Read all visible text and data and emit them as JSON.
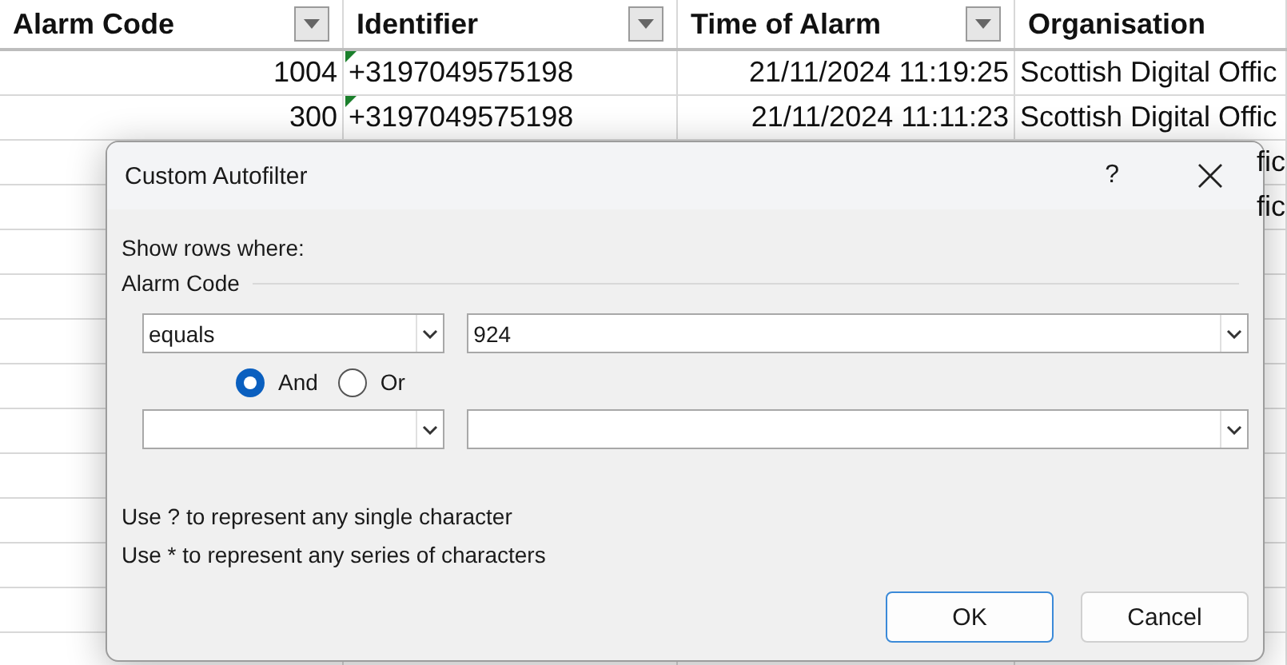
{
  "sheet": {
    "columns": [
      {
        "label": "Alarm Code",
        "filter": true
      },
      {
        "label": "Identifier",
        "filter": true
      },
      {
        "label": "Time of Alarm",
        "filter": true
      },
      {
        "label": "Organisation",
        "filter": false
      }
    ],
    "rows": [
      {
        "alarm_code": "1004",
        "identifier": "+3197049575198",
        "time": "21/11/2024 11:19:25",
        "organisation": "Scottish Digital Offic"
      },
      {
        "alarm_code": "300",
        "identifier": "+3197049575198",
        "time": "21/11/2024 11:11:23",
        "organisation": "Scottish Digital Offic"
      },
      {
        "organisation": "fic"
      },
      {
        "organisation": "fic"
      }
    ]
  },
  "dialog": {
    "title": "Custom Autofilter",
    "help": "?",
    "intro": "Show rows where:",
    "group": "Alarm Code",
    "conditions": [
      {
        "operator": "equals",
        "value": "924"
      }
    ],
    "joins": [
      {
        "label": "And",
        "selected": true
      },
      {
        "label": "Or",
        "selected": false
      }
    ],
    "hints": [
      "Use ? to represent any single character",
      "Use * to represent any series of characters"
    ],
    "buttons": [
      {
        "label": "OK",
        "default": true
      },
      {
        "label": "Cancel",
        "default": false
      }
    ]
  }
}
